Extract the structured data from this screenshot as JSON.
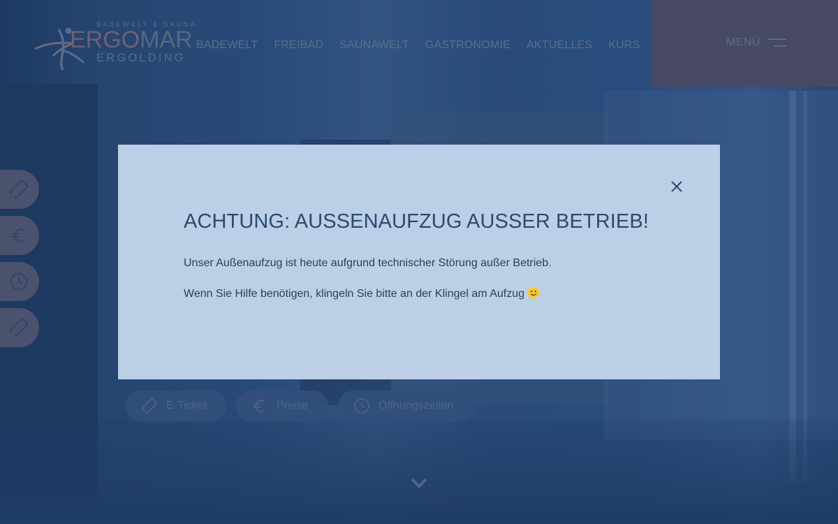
{
  "logo": {
    "tagline": "BADEWELT & SAUNA",
    "name_part1": "ERGO",
    "name_part2": "MAR",
    "city": "ERGOLDING"
  },
  "nav": {
    "items": [
      "BADEWELT",
      "FREIBAD",
      "SAUNAWELT",
      "GASTRONOMIE",
      "AKTUELLES",
      "KURS"
    ]
  },
  "menu": {
    "label": "MENÜ",
    "icon": "hamburger-icon"
  },
  "side_tabs": [
    {
      "icon": "ticket-icon"
    },
    {
      "icon": "euro-icon"
    },
    {
      "icon": "clock-icon"
    },
    {
      "icon": "ticket-icon"
    }
  ],
  "hero_buttons": [
    {
      "label": "E-Ticket",
      "icon": "ticket-icon"
    },
    {
      "label": "Preise",
      "icon": "euro-icon"
    },
    {
      "label": "Öffnungszeiten",
      "icon": "clock-icon"
    }
  ],
  "modal": {
    "title": "ACHTUNG: AUSSENAUFZUG AUSSER BETRIEB!",
    "paragraph1": "Unser Außenaufzug ist heute aufgrund technischer Störung außer Betrieb.",
    "paragraph2": "Wenn Sie Hilfe benötigen, klingeln Sie bitte an der Klingel am Aufzug",
    "close_icon": "close-icon",
    "emoji_icon": "smiley-icon"
  },
  "colors": {
    "modal_bg": "#bccfe6",
    "title_color": "#2b4a6e",
    "menu_bg": "#565069",
    "page_overlay": "#24446e"
  }
}
